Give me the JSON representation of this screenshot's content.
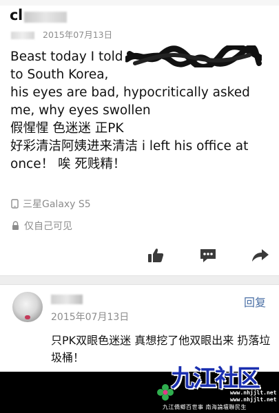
{
  "post": {
    "author": "cl",
    "meta_date": "2015年07月13日",
    "body_lines": [
      "Beast today I told",
      "to South Korea,",
      "his eyes are bad, hypocritically asked",
      "me, why eyes swollen",
      "假惺惺 色迷迷 正PK",
      "好彩清洁阿姨进来清洁 i left his office at",
      "once！ 唉 死贱精！"
    ],
    "device": "三星Galaxy S5",
    "privacy": "仅自己可见"
  },
  "actions": {
    "like_icon": "thumbs-up-icon",
    "comment_icon": "comment-icon",
    "share_icon": "share-arrow-icon"
  },
  "reply": {
    "date": "2015年07月13日",
    "button_label": "回复",
    "text": "只PK双眼色迷迷 真想挖了他双眼出来 扔落垃圾桶！"
  },
  "watermark": {
    "title": "九江社区",
    "url_1": "www.nhjjlt.net",
    "url_2": "www.nhjjlt.net",
    "slogan": "九江僑鄉百世事 南海論壇聯民生"
  },
  "colors": {
    "meta_gray": "#8c8c8c",
    "reply_blue": "#4a6fa5",
    "footer_black": "#000000",
    "watermark_blue": "#1a2fb0"
  }
}
